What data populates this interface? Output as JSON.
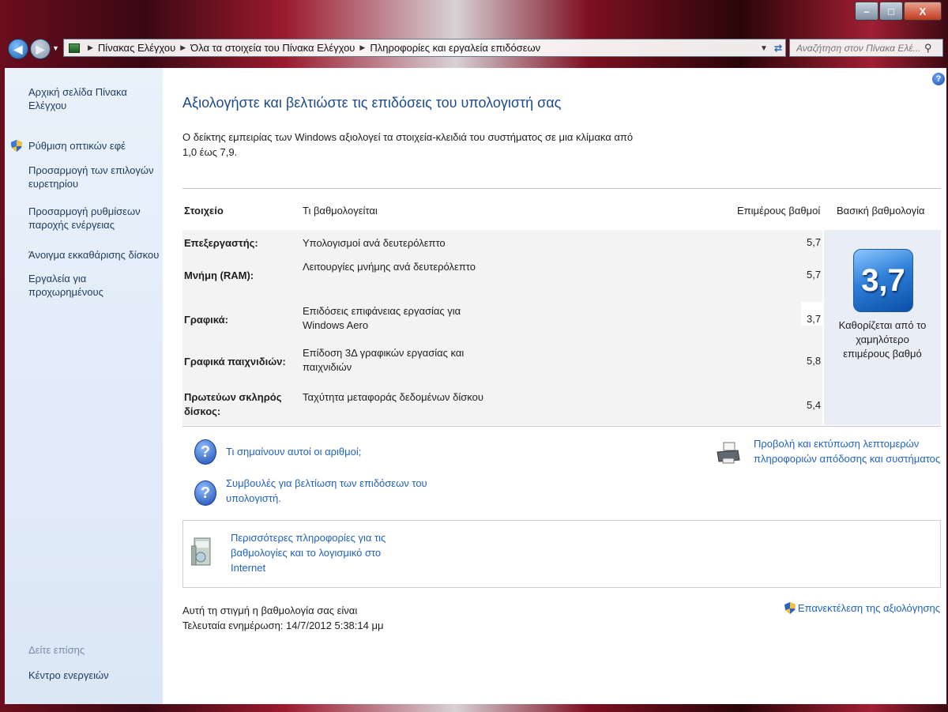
{
  "window": {
    "minimize": "–",
    "maximize": "□",
    "close": "X"
  },
  "address": {
    "crumbs": [
      "Πίνακας Ελέγχου",
      "Όλα τα στοιχεία του Πίνακα Ελέγχου",
      "Πληροφορίες και εργαλεία επιδόσεων"
    ]
  },
  "search": {
    "placeholder": "Αναζήτηση στον Πίνακα Ελέ..."
  },
  "sidebar": {
    "items": [
      {
        "label": "Αρχική σελίδα Πίνακα Ελέγχου"
      },
      {
        "label": "Ρύθμιση οπτικών εφέ"
      },
      {
        "label": "Προσαρμογή των επιλογών ευρετηρίου"
      },
      {
        "label": "Προσαρμογή ρυθμίσεων παροχής ενέργειας"
      },
      {
        "label": "Άνοιγμα εκκαθάρισης δίσκου"
      },
      {
        "label": "Εργαλεία για προχωρημένους"
      }
    ],
    "see_also_title": "Δείτε επίσης",
    "see_also_items": [
      {
        "label": "Κέντρο ενεργειών"
      }
    ]
  },
  "main": {
    "title": "Αξιολογήστε και βελτιώστε τις επιδόσεις του υπολογιστή σας",
    "intro": "Ο δείκτης εμπειρίας των Windows αξιολογεί τα στοιχεία-κλειδιά του συστήματος σε μια κλίμακα από 1,0 έως 7,9.",
    "table": {
      "headers": [
        "Στοιχείο",
        "Τι βαθμολογείται",
        "Επιμέρους βαθμοί",
        "Βασική βαθμολογία"
      ],
      "rows": [
        {
          "component": "Επεξεργαστής:",
          "desc": "Υπολογισμοί ανά δευτερόλεπτο",
          "score": "5,7"
        },
        {
          "component": "Μνήμη (RAM):",
          "desc": "Λειτουργίες μνήμης ανά δευτερόλεπτο",
          "score": "5,7"
        },
        {
          "component": "Γραφικά:",
          "desc": "Επιδόσεις επιφάνειας εργασίας για Windows Aero",
          "score": "3,7"
        },
        {
          "component": "Γραφικά παιχνιδιών:",
          "desc": "Επίδοση 3Δ γραφικών εργασίας και παιχνιδιών",
          "score": "5,8"
        },
        {
          "component": "Πρωτεύων σκληρός δίσκος:",
          "desc": "Ταχύτητα μεταφοράς δεδομένων δίσκου",
          "score": "5,4"
        }
      ],
      "base_score": "3,7",
      "base_caption": "Καθορίζεται από το χαμηλότερο επιμέρους βαθμό"
    },
    "links": {
      "what_numbers": "Τι σημαίνουν αυτοί οι αριθμοί;",
      "tips": "Συμβουλές για βελτίωση των επιδόσεων του υπολογιστή.",
      "print": "Προβολή και εκτύπωση λεπτομερών πληροφοριών απόδοσης και συστήματος",
      "more_info": "Περισσότερες πληροφορίες για τις βαθμολογίες και το λογισμικό στο Internet",
      "rerun": "Επανεκτέλεση της αξιολόγησης"
    },
    "status": {
      "line1": "Αυτή τη στιγμή η βαθμολογία σας είναι",
      "line2": "Τελευταία ενημέρωση: 14/7/2012 5:38:14 μμ"
    }
  },
  "colors": {
    "link": "#1f62c0",
    "title": "#1e4b8d",
    "sidebar_bg": "#e9f1fb",
    "badge": "#2e7fd8"
  }
}
